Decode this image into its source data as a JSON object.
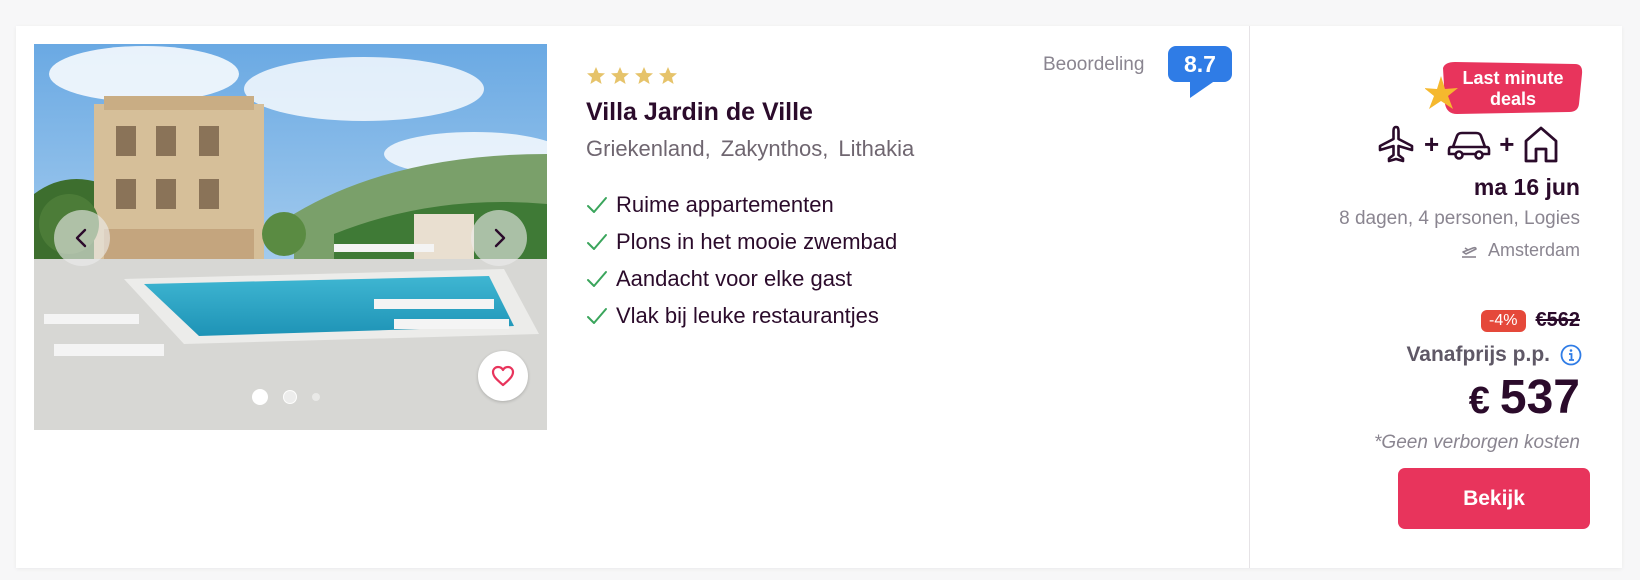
{
  "hotel": {
    "name": "Villa Jardin de Ville",
    "stars": 4,
    "location": [
      "Griekenland,",
      "Zakynthos,",
      "Lithakia"
    ],
    "features": [
      "Ruime appartementen",
      "Plons in het mooie zwembad",
      "Aandacht voor elke gast",
      "Vlak bij leuke restaurantjes"
    ]
  },
  "rating": {
    "label": "Beoordeling",
    "score": "8.7",
    "color": "#2f7ce6"
  },
  "gallery": {
    "image_count": 3,
    "active_index": 0
  },
  "deal": {
    "label_line1": "Last minute",
    "label_line2": "deals",
    "color": "#e8345c"
  },
  "transport": {
    "icons": [
      "plane-icon",
      "car-icon",
      "house-icon"
    ],
    "separator": "+"
  },
  "trip": {
    "date": "ma 16 jun",
    "details": "8 dagen, 4 personen, Logies",
    "departure": "Amsterdam"
  },
  "pricing": {
    "discount": "-4%",
    "old_price": "€562",
    "label": "Vanafprijs p.p.",
    "currency": "€",
    "amount": "537",
    "note": "*Geen verborgen kosten"
  },
  "cta": {
    "label": "Bekijk",
    "color": "#e8345c"
  }
}
